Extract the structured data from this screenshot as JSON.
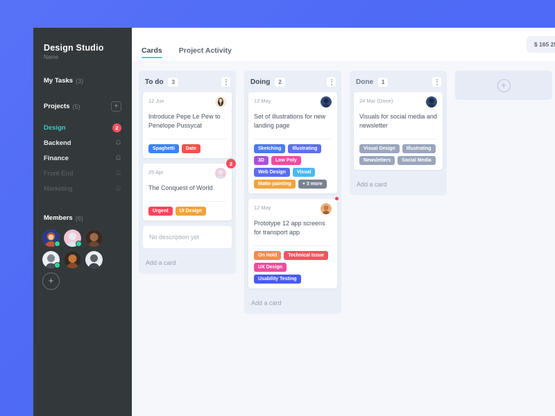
{
  "sidebar": {
    "brand_title": "Design Studio",
    "brand_subtitle": "Name",
    "my_tasks_label": "My Tasks",
    "my_tasks_count": "(3)",
    "projects_label": "Projects",
    "projects_count": "(5)",
    "add_project_icon": "plus-icon",
    "projects": [
      {
        "name": "Design",
        "badge": "2",
        "state": "active"
      },
      {
        "name": "Backend",
        "badge": null,
        "state": "normal"
      },
      {
        "name": "Finance",
        "badge": null,
        "state": "normal"
      },
      {
        "name": "Front-End",
        "badge": null,
        "state": "dim"
      },
      {
        "name": "Marketing",
        "badge": null,
        "state": "dim"
      }
    ],
    "members_label": "Members",
    "members_count": "(6)",
    "add_member_icon": "plus-icon"
  },
  "header": {
    "tabs": [
      {
        "label": "Cards",
        "active": true
      },
      {
        "label": "Project Activity",
        "active": false
      }
    ],
    "price_chip": "$ 165 25"
  },
  "board": {
    "add_column_icon": "plus-circle-icon",
    "columns": [
      {
        "title": "To do",
        "count": "3",
        "menu_icon": "kebab-menu-icon",
        "add_card_label": "Add a card",
        "cards": [
          {
            "date": "12 Jun",
            "title": "Introduce Pepe Le Pew to Penelope Pussycat",
            "badge": null,
            "dot": false,
            "tags": [
              {
                "label": "Spaghetti",
                "color": "#3b82f6"
              },
              {
                "label": "Date",
                "color": "#f0534f"
              }
            ]
          },
          {
            "date": "25 Apr",
            "title": "The Conquest of World",
            "badge": "2",
            "dot": false,
            "tags": [
              {
                "label": "Urgent",
                "color": "#f0485e"
              },
              {
                "label": "UI Design",
                "color": "#f4a23c"
              }
            ]
          }
        ],
        "empty_card_label": "No description yet"
      },
      {
        "title": "Doing",
        "count": "2",
        "menu_icon": "kebab-menu-icon",
        "add_card_label": "Add a card",
        "cards": [
          {
            "date": "12 May",
            "title": "Set of illustrations for new landing page",
            "badge": null,
            "dot": false,
            "tags": [
              {
                "label": "Sketching",
                "color": "#4b7bec"
              },
              {
                "label": "Illustrating",
                "color": "#5d6ff0"
              },
              {
                "label": "3D",
                "color": "#a855d6"
              },
              {
                "label": "Low Poly",
                "color": "#ef4d9e"
              },
              {
                "label": "Web Design",
                "color": "#5b6cf0"
              },
              {
                "label": "Visual",
                "color": "#4cb8f0"
              },
              {
                "label": "Matte-painting",
                "color": "#f5a33e"
              },
              {
                "label": "+ 3 more",
                "color": "#7a828f"
              }
            ]
          },
          {
            "date": "12 May",
            "title": "Prototype 12 app screens for transport app",
            "badge": null,
            "dot": true,
            "tags": [
              {
                "label": "On Hold",
                "color": "#f58b4c"
              },
              {
                "label": "Technical Issue",
                "color": "#f05561"
              },
              {
                "label": "UX Design",
                "color": "#ef4d9e"
              },
              {
                "label": "Usability Testing",
                "color": "#4a5cf0"
              }
            ]
          }
        ],
        "empty_card_label": null
      },
      {
        "title": "Done",
        "count": "1",
        "menu_icon": "kebab-menu-icon",
        "add_card_label": "Add a card",
        "cards": [
          {
            "date": "24 Mar (Done)",
            "title": "Visuals for social media and newsletter",
            "badge": null,
            "dot": false,
            "tags": [
              {
                "label": "Visual Design",
                "color": "#9aa6bd"
              },
              {
                "label": "Illustrating",
                "color": "#9aa6bd"
              },
              {
                "label": "Newsletters",
                "color": "#9aa6bd"
              },
              {
                "label": "Social Media",
                "color": "#9aa6bd"
              }
            ]
          }
        ],
        "empty_card_label": null
      }
    ]
  }
}
